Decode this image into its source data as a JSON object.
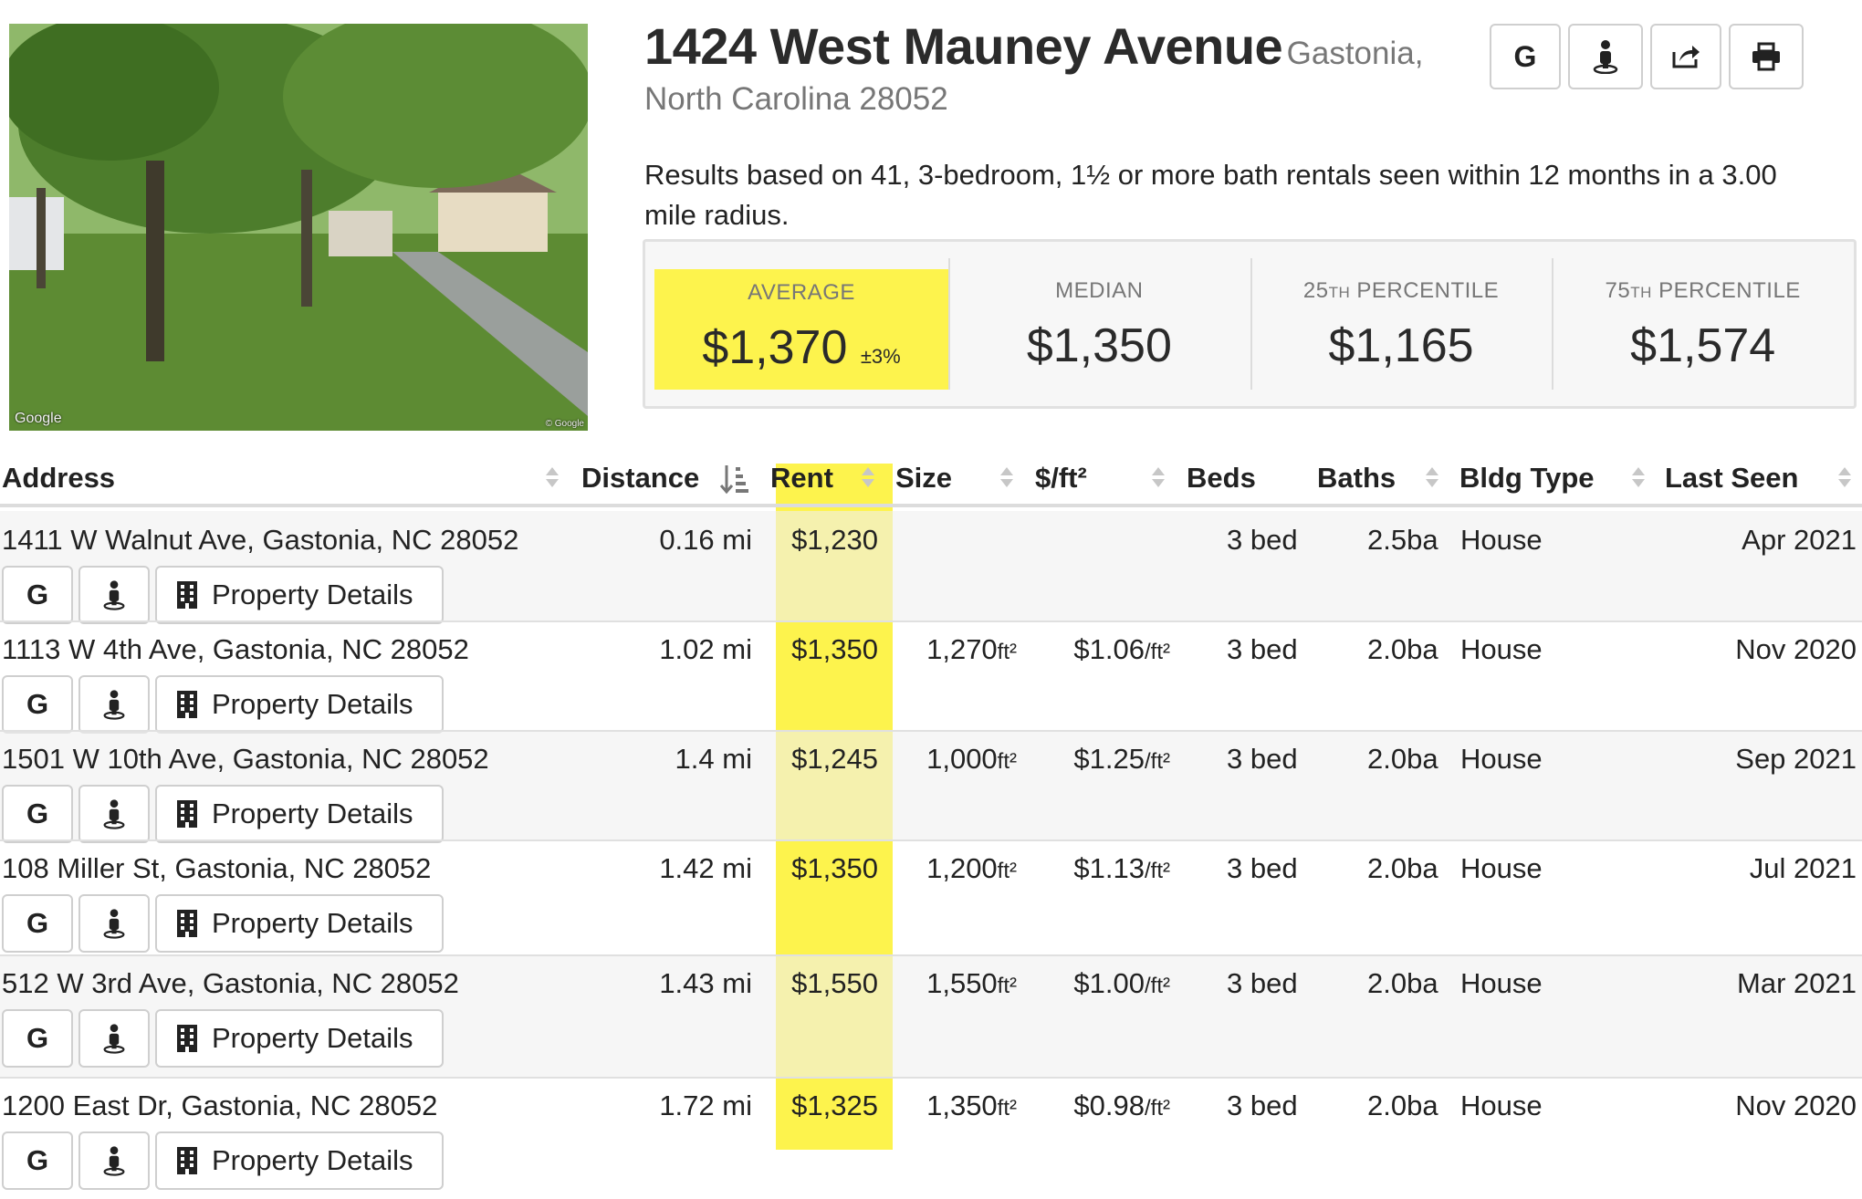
{
  "header": {
    "street": "1424 West Mauney Avenue",
    "city": "Gastonia,",
    "state_zip": "North Carolina 28052",
    "summary": "Results based on 41, 3-bedroom, 1½ or more bath rentals seen within 12 months in a 3.00 mile radius.",
    "photo_watermark": "Google",
    "photo_copyright": "© Google",
    "buttons": [
      {
        "id": "google",
        "label": "G",
        "icon": "google-icon"
      },
      {
        "id": "streetview",
        "icon": "street-view-person-icon"
      },
      {
        "id": "share",
        "icon": "share-icon"
      },
      {
        "id": "print",
        "icon": "print-icon"
      }
    ]
  },
  "stats": {
    "average": {
      "label": "AVERAGE",
      "value": "$1,370",
      "margin": "±3%"
    },
    "median": {
      "label": "MEDIAN",
      "value": "$1,350"
    },
    "p25": {
      "label_num": "25",
      "label_sup": "TH",
      "label_rest": " PERCENTILE",
      "value": "$1,165"
    },
    "p75": {
      "label_num": "75",
      "label_sup": "TH",
      "label_rest": " PERCENTILE",
      "value": "$1,574"
    }
  },
  "table": {
    "columns": {
      "address": "Address",
      "distance": "Distance",
      "rent": "Rent",
      "size": "Size",
      "ppsf": "$/ft²",
      "beds": "Beds",
      "baths": "Baths",
      "bldg_type": "Bldg Type",
      "last_seen": "Last Seen"
    },
    "details_label": "Property Details",
    "google_label": "G",
    "rows": [
      {
        "address": "1411 W Walnut Ave, Gastonia, NC 28052",
        "distance": "0.16",
        "rent": "$1,230",
        "size": "",
        "ppsf": "",
        "beds": "3 bed",
        "baths": "2.5ba",
        "type": "House",
        "last_seen": "Apr 2021"
      },
      {
        "address": "1113 W 4th Ave, Gastonia, NC 28052",
        "distance": "1.02",
        "rent": "$1,350",
        "size": "1,270",
        "ppsf": "$1.06",
        "beds": "3 bed",
        "baths": "2.0ba",
        "type": "House",
        "last_seen": "Nov 2020"
      },
      {
        "address": "1501 W 10th Ave, Gastonia, NC 28052",
        "distance": "1.4",
        "rent": "$1,245",
        "size": "1,000",
        "ppsf": "$1.25",
        "beds": "3 bed",
        "baths": "2.0ba",
        "type": "House",
        "last_seen": "Sep 2021"
      },
      {
        "address": "108 Miller St, Gastonia, NC 28052",
        "distance": "1.42",
        "rent": "$1,350",
        "size": "1,200",
        "ppsf": "$1.13",
        "beds": "3 bed",
        "baths": "2.0ba",
        "type": "House",
        "last_seen": "Jul 2021"
      },
      {
        "address": "512 W 3rd Ave, Gastonia, NC 28052",
        "distance": "1.43",
        "rent": "$1,550",
        "size": "1,550",
        "ppsf": "$1.00",
        "beds": "3 bed",
        "baths": "2.0ba",
        "type": "House",
        "last_seen": "Mar 2021"
      },
      {
        "address": "1200 East Dr, Gastonia, NC 28052",
        "distance": "1.72",
        "rent": "$1,325",
        "size": "1,350",
        "ppsf": "$0.98",
        "beds": "3 bed",
        "baths": "2.0ba",
        "type": "House",
        "last_seen": "Nov 2020"
      }
    ],
    "units": {
      "distance": "mi",
      "size": "ft²",
      "ppsf": "/ft²"
    }
  },
  "colors": {
    "highlight": "#fdf34d",
    "border": "#cfcfcf",
    "muted_text": "#777777"
  }
}
